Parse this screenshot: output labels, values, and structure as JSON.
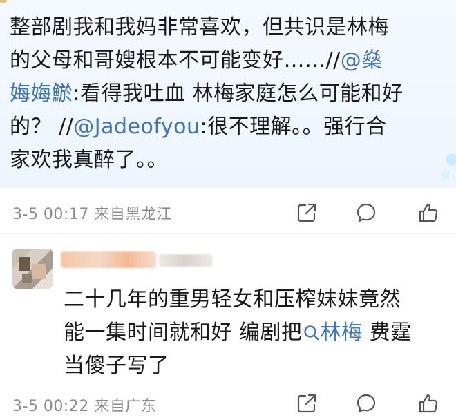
{
  "post": {
    "lines": [
      {
        "text": "整部剧我和我妈非常喜欢，但共识是林梅"
      },
      {
        "text": "的父母和哥嫂根本不可能变好……//",
        "mention": "@燊"
      },
      {
        "mention": "娒娒鯲",
        "text": ":看得我吐血 林梅家庭怎么可能和好"
      },
      {
        "pre": "的？ //",
        "mention": "@Jadeofyou",
        "text": ":很不理解。。强行合"
      },
      {
        "text": "家欢我真醉了。。"
      }
    ],
    "meta": "3-5 00:17  来自黑龙江"
  },
  "reply": {
    "lines": [
      {
        "text": "二十几年的重男轻女和压榨妹妹竟然"
      },
      {
        "text": "能一集时间就和好 编剧把",
        "topic": "林梅",
        "after": " 费霆"
      },
      {
        "text": "当傻子写了"
      }
    ],
    "meta": "3-5 00:22  来自广东"
  },
  "icons": {
    "share": "share-icon",
    "comment": "comment-icon",
    "like": "like-icon",
    "search": "search-icon"
  },
  "colors": {
    "mention": "#3f74b7",
    "meta": "#8a8a8a",
    "post_bg": "#eef5fd"
  }
}
